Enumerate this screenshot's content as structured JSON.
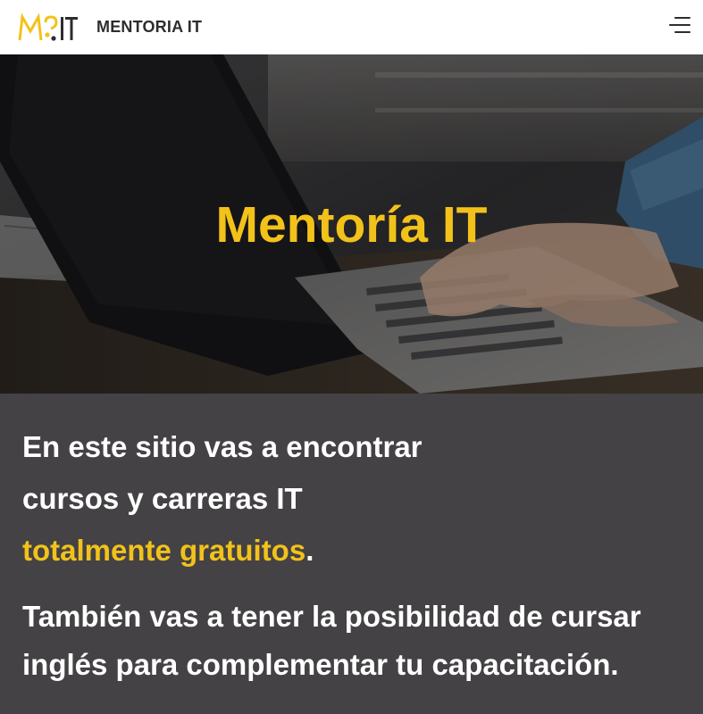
{
  "header": {
    "logo_text": "M IT",
    "brand": "MENTORIA IT",
    "menu_icon": "hamburger-menu-icon"
  },
  "hero": {
    "title": "Mentoría IT",
    "image": "laptop-typing-photo"
  },
  "intro": {
    "line1": "En este sitio vas a encontrar",
    "line2": "cursos y carreras IT",
    "highlight": "totalmente gratuitos",
    "period": "."
  },
  "secondary": {
    "line1": "También vas a tener la posibilidad de cursar",
    "line2": "inglés para complementar tu capacitación."
  },
  "colors": {
    "accent": "#f2c21b",
    "panel": "#444244",
    "header_bg": "#ffffff",
    "text_dark": "#2d2d2d"
  }
}
